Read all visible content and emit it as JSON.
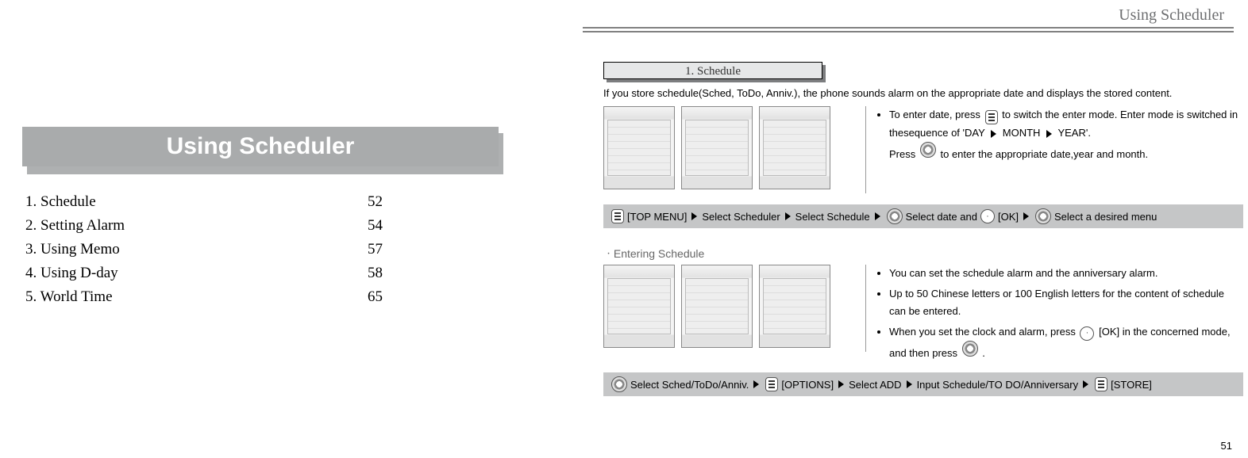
{
  "left": {
    "title": "Using Scheduler",
    "toc": [
      {
        "label": "1. Schedule",
        "page": "52"
      },
      {
        "label": "2. Setting Alarm",
        "page": "54"
      },
      {
        "label": "3. Using Memo",
        "page": "57"
      },
      {
        "label": "4. Using D-day",
        "page": "58"
      },
      {
        "label": "5. World Time",
        "page": "65"
      }
    ]
  },
  "right": {
    "header": "Using Scheduler",
    "section_tab": "1. Schedule",
    "intro": "If you store schedule(Sched, ToDo, Anniv.), the phone sounds alarm on the appropriate date and displays the stored content.",
    "bullets_top": {
      "line1": "To enter date, press",
      "line2": "to switch the enter mode. Enter mode is switched in thesequence of 'DAY",
      "line3": "MONTH",
      "line4": "YEAR'.",
      "line5": "Press",
      "line6": "to enter the appropriate date,year and month."
    },
    "bar1": {
      "p1": "[TOP MENU]",
      "p2": "Select Scheduler",
      "p3": "Select Schedule",
      "p4": "Select date and",
      "p5": "[OK]",
      "p6": "Select a desired menu"
    },
    "subhead": "ㆍEntering Schedule",
    "bullets_bottom": {
      "b1": "You can set the schedule alarm and the anniversary alarm.",
      "b2": "Up to 50 Chinese letters or 100 English letters for the content of schedule can be entered.",
      "b3a": "When you set the clock and alarm, press",
      "b3b": "[OK] in the concerned mode, and then press",
      "b3c": "."
    },
    "bar2": {
      "p1": "Select Sched/ToDo/Anniv.",
      "p2": "[OPTIONS]",
      "p3": "Select ADD",
      "p4": "Input Schedule/TO DO/Anniversary",
      "p5": "[STORE]"
    },
    "page_number": "51"
  }
}
